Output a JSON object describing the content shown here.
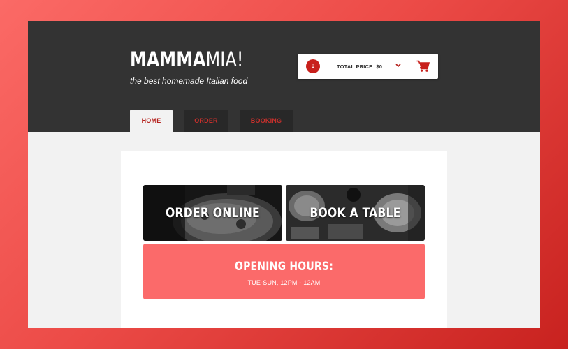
{
  "brand": {
    "logo_bold": "MAMMA",
    "logo_light": "MIA!",
    "tagline": "the best homemade Italian food"
  },
  "cart": {
    "count": "0",
    "total_label": "TOTAL PRICE: $0",
    "toggle_icon": "chevron-down-icon",
    "cart_icon": "shopping-cart-icon",
    "accent_color": "#c8201c"
  },
  "nav": {
    "tabs": [
      {
        "label": "HOME",
        "active": true
      },
      {
        "label": "ORDER",
        "active": false
      },
      {
        "label": "BOOKING",
        "active": false
      }
    ]
  },
  "main": {
    "tiles": [
      {
        "label": "ORDER ONLINE"
      },
      {
        "label": "BOOK A TABLE"
      }
    ],
    "hours": {
      "title": "OPENING HOURS:",
      "times": "TUE-SUN, 12PM - 12AM",
      "color": "#fb6a6a"
    }
  },
  "theme": {
    "header_bg": "#333333",
    "page_bg": "#f2f2f2",
    "brand_red": "#b51f1b"
  }
}
